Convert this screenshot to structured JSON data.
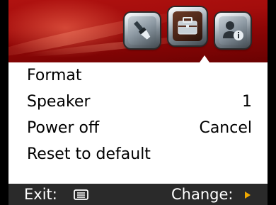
{
  "menu": {
    "items": [
      {
        "label": "Format",
        "value": ""
      },
      {
        "label": "Speaker",
        "value": "1"
      },
      {
        "label": "Power off",
        "value": "Cancel"
      },
      {
        "label": "Reset to default",
        "value": ""
      }
    ]
  },
  "tabs": [
    {
      "icon": "brush-icon",
      "active": false
    },
    {
      "icon": "toolbox-icon",
      "active": true
    },
    {
      "icon": "person-info-icon",
      "active": false
    }
  ],
  "footer": {
    "exit_label": "Exit:",
    "exit_icon": "menu-button-icon",
    "change_label": "Change:",
    "change_icon": "right-arrow-icon"
  },
  "colors": {
    "header_red": "#a40d0c",
    "footer_bg": "#2a2a2a",
    "arrow": "#f0a800"
  }
}
